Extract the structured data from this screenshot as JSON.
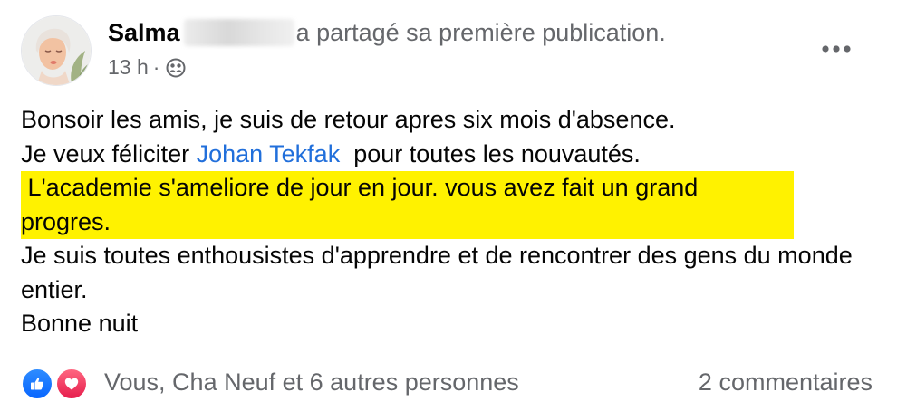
{
  "post": {
    "author": "Salma",
    "action": "a partagé sa première publication.",
    "time": "13 h",
    "meta_separator": "·",
    "privacy_icon": "friends-icon",
    "more_icon": "more-horizontal-icon"
  },
  "content": {
    "line1": "Bonsoir les amis, je suis de retour apres six mois d'absence.",
    "line2_prefix": "Je veux féliciter ",
    "mention": "Johan Tekfak",
    "line2_suffix": "  pour toutes les nouvautés.",
    "highlighted": " L'academie s'ameliore de jour en jour. vous avez fait un grand progres.",
    "line4": "Je suis toutes enthousistes d'apprendre et de rencontrer des gens du monde entier.",
    "line5": "Bonne nuit",
    "highlight_color": "#fff200",
    "mention_color": "#216fdb"
  },
  "footer": {
    "reactions_text": "Vous, Cha Neuf et 6 autres personnes",
    "comments_text": "2 commentaires",
    "reaction_icons": [
      "like-icon",
      "love-icon"
    ]
  }
}
